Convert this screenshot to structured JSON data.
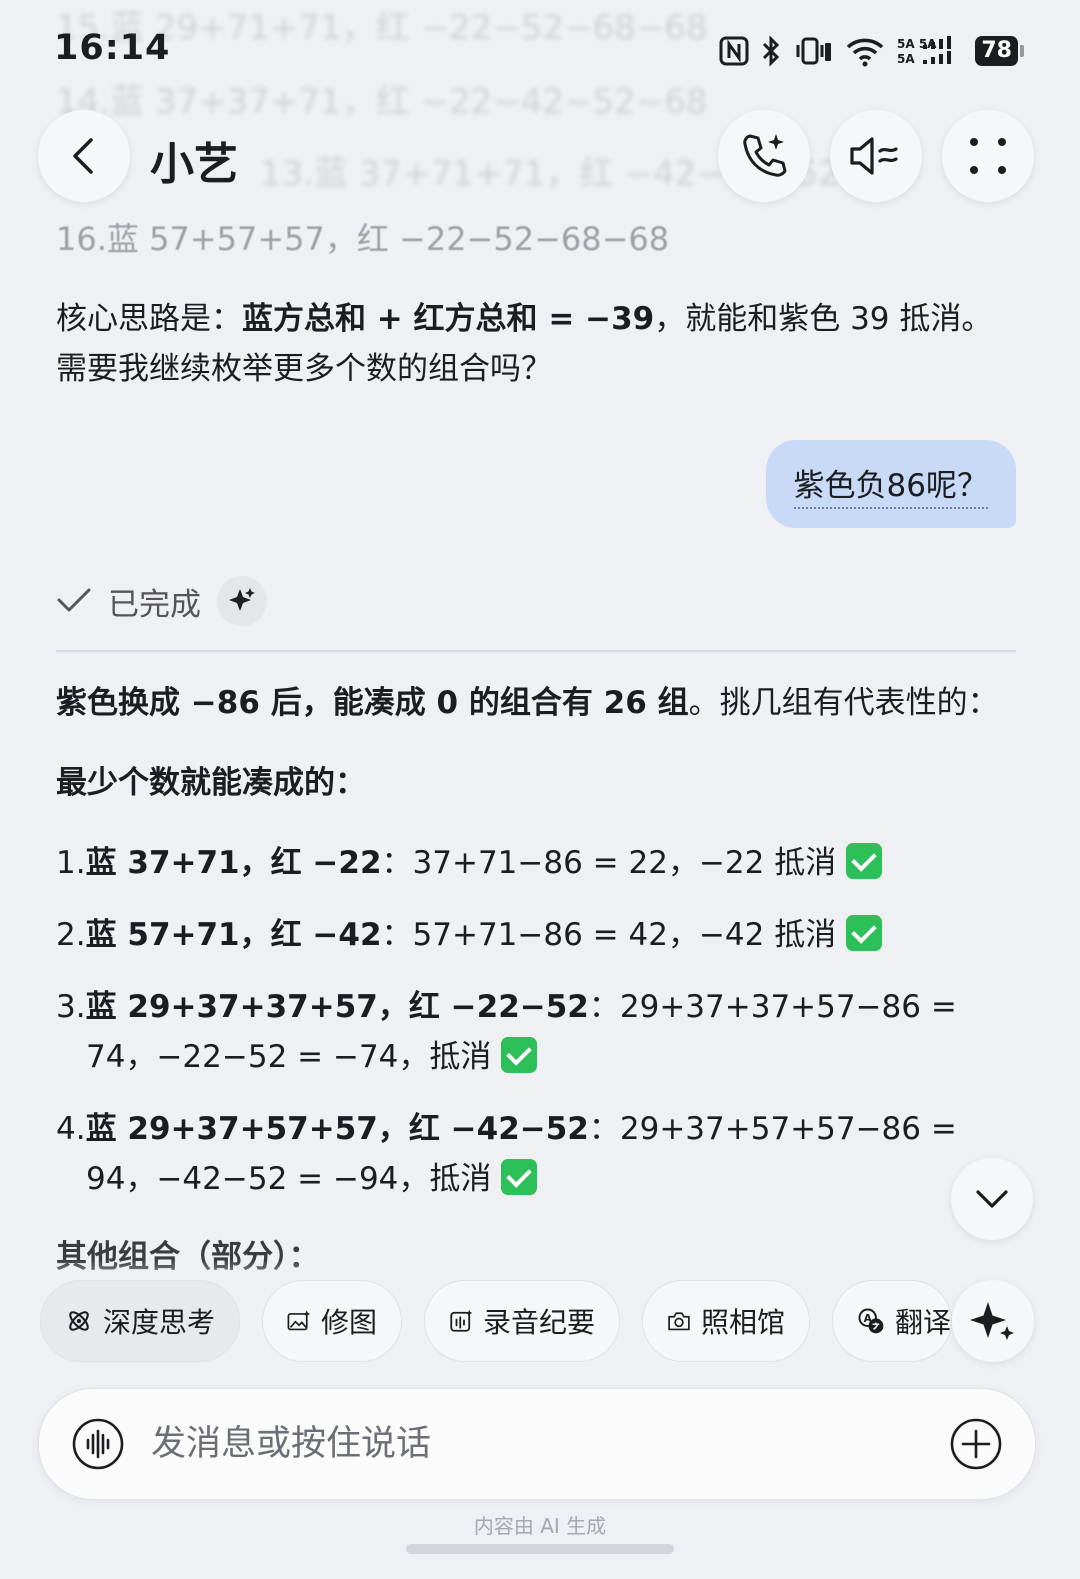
{
  "status_bar": {
    "time": "16:14",
    "battery": "78",
    "signal": "5A 5A"
  },
  "header": {
    "title": "小艺"
  },
  "bg_messages": [
    "15.蓝 29+71+71，红 −22−52−68−68",
    "14.蓝 37+37+71，红 −22−42−52−68",
    "13.蓝 37+71+71，红 −42−42−52−68",
    "16.蓝 57+57+57，红 −22−52−68−68"
  ],
  "prev_answer": {
    "line1_prefix": "核心思路是：",
    "line1_bold": "蓝方总和 + 红方总和 = −39",
    "line1_suffix": "，就能和紫色 39 抵消。",
    "line2": "需要我继续枚举更多个数的组合吗？"
  },
  "user_message": "紫色负86呢？",
  "status": {
    "done_label": "已完成"
  },
  "answer": {
    "summary_bold": "紫色换成 −86 后，能凑成 0 的组合有 26 组",
    "summary_rest": "。挑几组有代表性的：",
    "section1": "最少个数就能凑成的：",
    "items": [
      {
        "num": "1.",
        "bold": "蓝 37+71，红 −22",
        "rest": "：37+71−86 = 22，−22 抵消",
        "rest2": ""
      },
      {
        "num": "2.",
        "bold": "蓝 57+71，红 −42",
        "rest": "：57+71−86 = 42，−42 抵消",
        "rest2": ""
      },
      {
        "num": "3.",
        "bold": "蓝 29+37+37+57，红 −22−52",
        "rest": "：29+37+37+57−86 =",
        "rest2": "74，−22−52 = −74，抵消"
      },
      {
        "num": "4.",
        "bold": "蓝 29+37+57+57，红 −42−52",
        "rest": "：29+37+57+57−86 =",
        "rest2": "94，−42−52 = −94，抵消"
      }
    ],
    "section2": "其他组合（部分）："
  },
  "chips": [
    "深度思考",
    "修图",
    "录音纪要",
    "照相馆",
    "翻译"
  ],
  "input": {
    "placeholder": "发消息或按住说话"
  },
  "footer_note": "内容由 AI 生成",
  "colors": {
    "bubble": "#c9daf7",
    "check": "#2dbf58",
    "background": "#eef0f4"
  }
}
